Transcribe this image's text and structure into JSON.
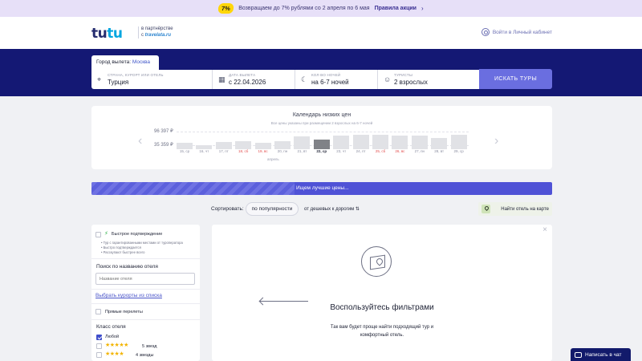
{
  "promo": {
    "badge": "7%",
    "text": "Возвращаем до 7% рублями со 2 апреля по 6 мая",
    "link": "Правила акции",
    "chevron": "›"
  },
  "header": {
    "logo_main": "tu",
    "logo_accent": "tu",
    "partner_line1": "в партнёрстве",
    "partner_line2": "с",
    "partner_brand": "travelata.ru",
    "login": "Войти в Личный кабинет"
  },
  "search": {
    "city_label": "Город вылета:",
    "city_value": "Москва",
    "destination": {
      "label": "СТРАНА, КУРОРТ ИЛИ ОТЕЛЬ",
      "value": "Турция",
      "icon": "location-pin-icon"
    },
    "date": {
      "label": "ДАТА ВЫЛЕТА",
      "value": "с 22.04.2026",
      "icon": "calendar-icon"
    },
    "nights": {
      "label": "КОЛ-ВО НОЧЕЙ",
      "value": "на 6-7 ночей",
      "icon": "moon-icon"
    },
    "tourists": {
      "label": "ТУРИСТЫ",
      "value": "2 взрослых",
      "icon": "person-icon"
    },
    "button": "ИСКАТЬ ТУРЫ"
  },
  "calendar": {
    "title": "Календарь низких цен",
    "subtitle": "Все цены указаны при размещении 2 взрослых на 6-7 ночей",
    "max_price": "96 397 ₽",
    "min_price": "35 359 ₽",
    "month": "апрель",
    "prev_arrow": "‹",
    "next_arrow": "›",
    "days": [
      {
        "label": "15, ср",
        "level": 0.38,
        "weekend": false,
        "selected": false
      },
      {
        "label": "16, чт",
        "level": 0.26,
        "weekend": false,
        "selected": false
      },
      {
        "label": "17, пт",
        "level": 0.42,
        "weekend": false,
        "selected": false
      },
      {
        "label": "18, сб",
        "level": 0.46,
        "weekend": true,
        "selected": false
      },
      {
        "label": "19, вс",
        "level": 0.4,
        "weekend": true,
        "selected": false
      },
      {
        "label": "20, пн",
        "level": 0.48,
        "weekend": false,
        "selected": false
      },
      {
        "label": "21, вт",
        "level": 0.78,
        "weekend": false,
        "selected": false
      },
      {
        "label": "22, ср",
        "level": 0.55,
        "weekend": false,
        "selected": true
      },
      {
        "label": "23, чт",
        "level": 0.82,
        "weekend": false,
        "selected": false
      },
      {
        "label": "24, пт",
        "level": 0.88,
        "weekend": false,
        "selected": false
      },
      {
        "label": "25, сб",
        "level": 0.85,
        "weekend": true,
        "selected": false
      },
      {
        "label": "26, вс",
        "level": 0.8,
        "weekend": true,
        "selected": false
      },
      {
        "label": "27, пн",
        "level": 0.8,
        "weekend": false,
        "selected": false
      },
      {
        "label": "28, вт",
        "level": 0.66,
        "weekend": false,
        "selected": false
      },
      {
        "label": "29, ср",
        "level": 0.86,
        "weekend": false,
        "selected": false
      }
    ]
  },
  "progress": {
    "text": "Ищем лучшие цены...",
    "level": 0.44
  },
  "sort": {
    "label": "Сортировать:",
    "option_popular": "по популярности",
    "option_price": "от дешевых к дорогим",
    "price_icon": "sort-icon",
    "map_button": "Найти отель на карте"
  },
  "filters": {
    "fast_confirm": "Быстрое подтверждение",
    "fast_bullets": [
      "• Тур с гарантированными местами от туроператора",
      "• Быстро подтверждается",
      "• Расскупают быстрее всего"
    ],
    "hotel_search_label": "Поиск по названию отеля",
    "hotel_search_placeholder": "Название отеля",
    "choose_resorts": "Выбрать курорты из списка",
    "direct_flights": "Прямые перелеты",
    "hotel_class_label": "Класс отеля",
    "any": "Любой",
    "five_stars": "5 звезд",
    "four_stars": "4 звезды",
    "five_stars_glyphs": "★★★★★",
    "four_stars_glyphs": "★★★★"
  },
  "empty_state": {
    "close": "×",
    "title": "Воспользуйтесь фильтрами",
    "text": "Так вам будет проще найти подходящий тур и комфортный отель."
  },
  "chat": {
    "label": "Написать в чат"
  },
  "colors": {
    "band": "#141874",
    "accent": "#6a6ee0",
    "weekend": "#e24c4c",
    "star": "#f2b400"
  }
}
